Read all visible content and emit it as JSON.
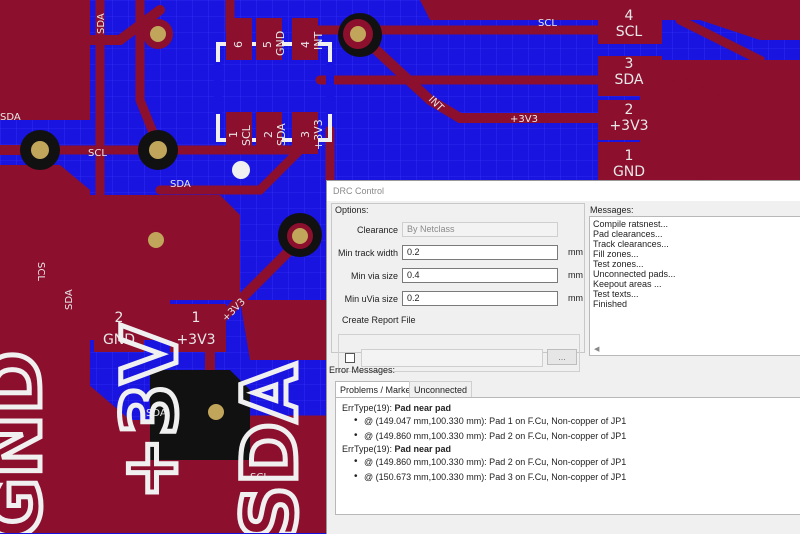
{
  "board": {
    "u1_pins": [
      {
        "num": "6",
        "name": ""
      },
      {
        "num": "5",
        "name": "GND"
      },
      {
        "num": "4",
        "name": "INT"
      },
      {
        "num": "1",
        "name": "SCL"
      },
      {
        "num": "2",
        "name": "SDA"
      },
      {
        "num": "3",
        "name": "+3V3"
      }
    ],
    "connector_right": [
      {
        "num": "4",
        "name": "SCL"
      },
      {
        "num": "3",
        "name": "SDA"
      },
      {
        "num": "2",
        "name": "+3V3"
      },
      {
        "num": "1",
        "name": "GND"
      }
    ],
    "connector_left": [
      {
        "num": "2",
        "name": "GND"
      },
      {
        "num": "1",
        "name": "+3V3"
      }
    ],
    "net_labels": {
      "scl": "SCL",
      "sda": "SDA",
      "v33": "+3V3",
      "int": "INT"
    },
    "silk_text": [
      "GND",
      "+3V",
      "SDA",
      "SCL"
    ],
    "colors": {
      "background": "#1a14e0",
      "copper": "#8c0f2e",
      "pad": "#c0a55a",
      "silkscreen": "#f0f0f0"
    }
  },
  "dialog": {
    "title": "DRC Control",
    "options_label": "Options:",
    "clearance": {
      "label": "Clearance",
      "value": "By Netclass"
    },
    "min_track_width": {
      "label": "Min track width",
      "value": "0.2",
      "unit": "mm"
    },
    "min_via_size": {
      "label": "Min via size",
      "value": "0.4",
      "unit": "mm"
    },
    "min_uvia_size": {
      "label": "Min uVia size",
      "value": "0.2",
      "unit": "mm"
    },
    "report": {
      "label": "Create Report File",
      "browse_label": "...",
      "checked": false
    },
    "messages_label": "Messages:",
    "messages": [
      "Compile ratsnest...",
      "Pad clearances...",
      "Track clearances...",
      "Fill zones...",
      "Test zones...",
      "Unconnected pads...",
      "Keepout areas ...",
      "Test texts...",
      "Finished"
    ],
    "error_messages_label": "Error Messages:",
    "tabs": [
      {
        "label": "Problems / Markers",
        "active": true
      },
      {
        "label": "Unconnected",
        "active": false
      }
    ],
    "errors": [
      {
        "type": "ErrType(19):",
        "title": "Pad near pad",
        "items": [
          "@ (149.047 mm,100.330 mm): Pad 1 on F.Cu, Non-copper of JP1",
          "@ (149.860 mm,100.330 mm): Pad 2 on F.Cu, Non-copper of JP1"
        ]
      },
      {
        "type": "ErrType(19):",
        "title": "Pad near pad",
        "items": [
          "@ (149.860 mm,100.330 mm): Pad 2 on F.Cu, Non-copper of JP1",
          "@ (150.673 mm,100.330 mm): Pad 3 on F.Cu, Non-copper of JP1"
        ]
      }
    ]
  }
}
